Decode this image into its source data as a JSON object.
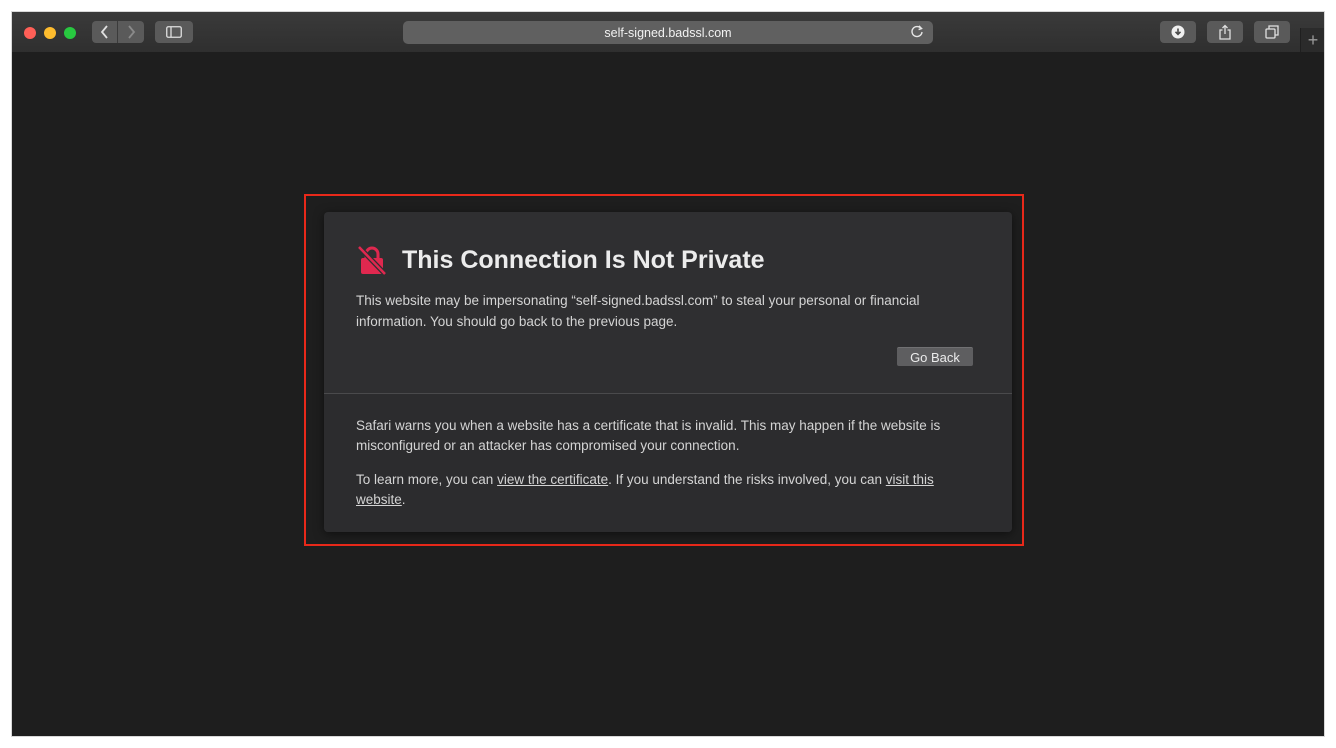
{
  "browser": {
    "url": "self-signed.badssl.com",
    "traffic_lights": {
      "close": "#ff5f57",
      "minimize": "#febc2e",
      "zoom": "#28c840"
    },
    "new_tab_label": "+"
  },
  "warning": {
    "title": "This Connection Is Not Private",
    "description": "This website may be impersonating “self-signed.badssl.com” to steal your personal or financial information. You should go back to the previous page.",
    "go_back_label": "Go Back",
    "details_paragraph": "Safari warns you when a website has a certificate that is invalid. This may happen if the website is misconfigured or an attacker has compromised your connection.",
    "learn_more_prefix": "To learn more, you can ",
    "view_certificate_link": "view the certificate",
    "learn_more_middle": ". If you understand the risks involved, you can ",
    "visit_website_link": "visit this website",
    "learn_more_suffix": ".",
    "icon": "broken-lock-icon",
    "icon_color": "#e0284f"
  },
  "annotation": {
    "highlight_color": "#e8291a"
  }
}
